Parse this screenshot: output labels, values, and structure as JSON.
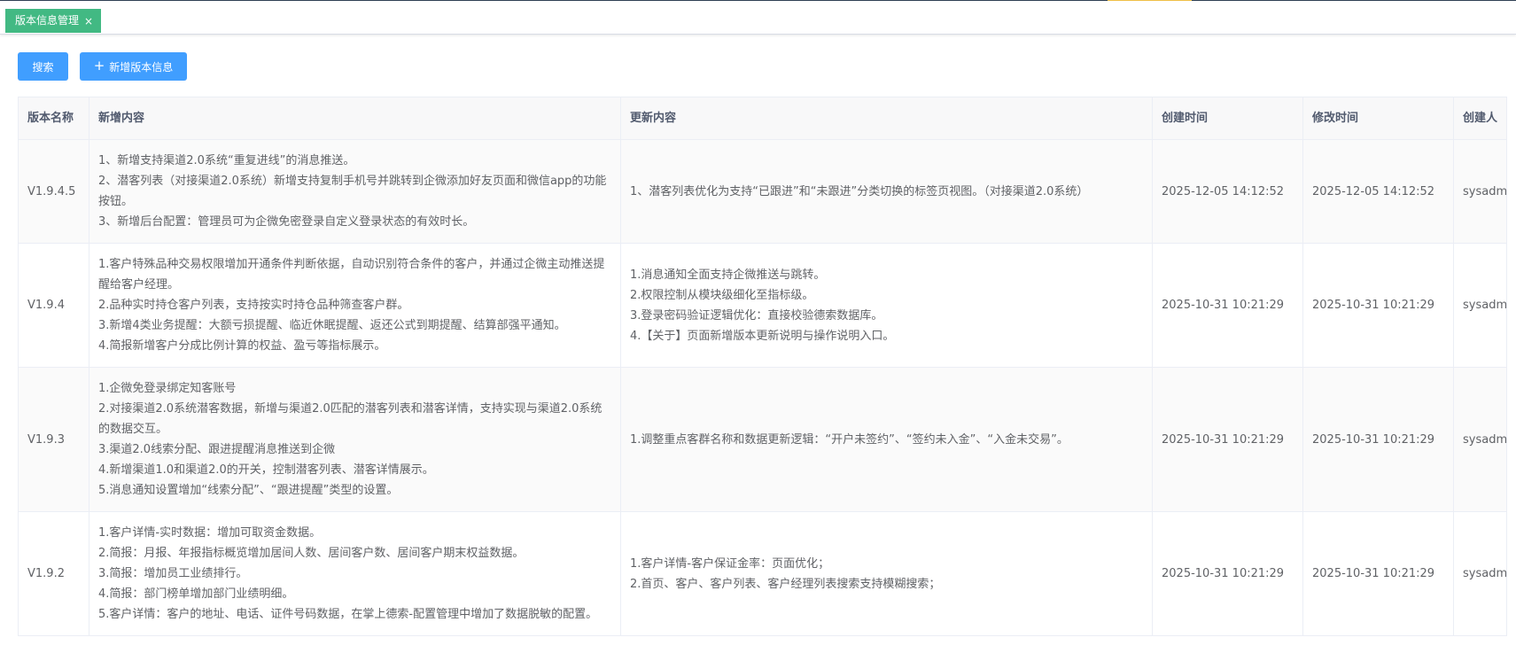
{
  "tabs": [
    {
      "label": "版本信息管理",
      "close": "×"
    }
  ],
  "toolbar": {
    "search_label": "搜索",
    "add_label": "新增版本信息",
    "add_icon": "plus-icon"
  },
  "table": {
    "columns": [
      "版本名称",
      "新增内容",
      "更新内容",
      "创建时间",
      "修改时间",
      "创建人"
    ],
    "rows": [
      {
        "version": "V1.9.4.5",
        "added": [
          "1、新增支持渠道2.0系统“重复进线”的消息推送。",
          "2、潜客列表（对接渠道2.0系统）新增支持复制手机号并跳转到企微添加好友页面和微信app的功能按钮。",
          "3、新增后台配置：管理员可为企微免密登录自定义登录状态的有效时长。"
        ],
        "updated": [
          "1、潜客列表优化为支持“已跟进”和“未跟进”分类切换的标签页视图。（对接渠道2.0系统）"
        ],
        "created": "2025-12-05 14:12:52",
        "modified": "2025-12-05 14:12:52",
        "creator": "sysadmin"
      },
      {
        "version": "V1.9.4",
        "added": [
          "1.客户特殊品种交易权限增加开通条件判断依据，自动识别符合条件的客户，并通过企微主动推送提醒给客户经理。",
          "2.品种实时持仓客户列表，支持按实时持仓品种筛查客户群。",
          "3.新增4类业务提醒：大额亏损提醒、临近休眠提醒、返还公式到期提醒、结算部强平通知。",
          "4.简报新增客户分成比例计算的权益、盈亏等指标展示。"
        ],
        "updated": [
          "1.消息通知全面支持企微推送与跳转。",
          "2.权限控制从模块级细化至指标级。",
          "3.登录密码验证逻辑优化：直接校验德索数据库。",
          "4.【关于】页面新增版本更新说明与操作说明入口。"
        ],
        "created": "2025-10-31 10:21:29",
        "modified": "2025-10-31 10:21:29",
        "creator": "sysadmin"
      },
      {
        "version": "V1.9.3",
        "added": [
          "1.企微免登录绑定知客账号",
          "2.对接渠道2.0系统潜客数据，新增与渠道2.0匹配的潜客列表和潜客详情，支持实现与渠道2.0系统的数据交互。",
          "3.渠道2.0线索分配、跟进提醒消息推送到企微",
          "4.新增渠道1.0和渠道2.0的开关，控制潜客列表、潜客详情展示。",
          "5.消息通知设置增加“线索分配”、“跟进提醒”类型的设置。"
        ],
        "updated": [
          "1.调整重点客群名称和数据更新逻辑：“开户未签约”、“签约未入金”、“入金未交易”。"
        ],
        "created": "2025-10-31 10:21:29",
        "modified": "2025-10-31 10:21:29",
        "creator": "sysadmin"
      },
      {
        "version": "V1.9.2",
        "added": [
          "1.客户详情-实时数据：增加可取资金数据。",
          "2.简报：月报、年报指标概览增加居间人数、居间客户数、居间客户期末权益数据。",
          "3.简报：增加员工业绩排行。",
          "4.简报：部门榜单增加部门业绩明细。",
          "5.客户详情：客户的地址、电话、证件号码数据，在掌上德索-配置管理中增加了数据脱敏的配置。"
        ],
        "updated": [
          "1.客户详情-客户保证金率：页面优化；",
          "2.首页、客户、客户列表、客户经理列表搜索支持模糊搜索；"
        ],
        "created": "2025-10-31 10:21:29",
        "modified": "2025-10-31 10:21:29",
        "creator": "sysadmin"
      }
    ]
  }
}
